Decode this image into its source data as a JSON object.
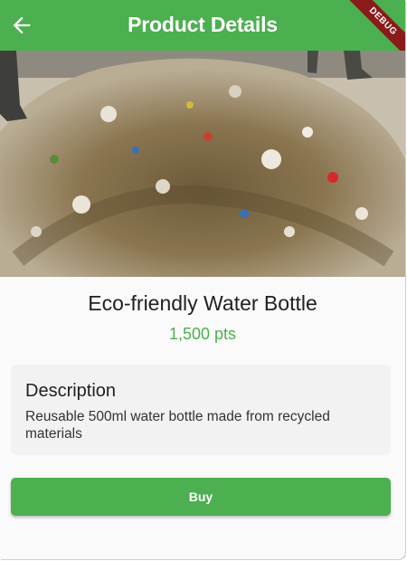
{
  "appbar": {
    "title": "Product Details",
    "back_icon": "arrow-left-icon",
    "debug_label": "DEBUG",
    "color": "#4caf50"
  },
  "product": {
    "image_icon": "product-photo",
    "name": "Eco-friendly Water Bottle",
    "price": "1,500 pts",
    "price_color": "#4caf50"
  },
  "description": {
    "title": "Description",
    "text": "Reusable 500ml water bottle made from recycled materials"
  },
  "actions": {
    "buy_label": "Buy",
    "buy_color": "#4caf50"
  }
}
